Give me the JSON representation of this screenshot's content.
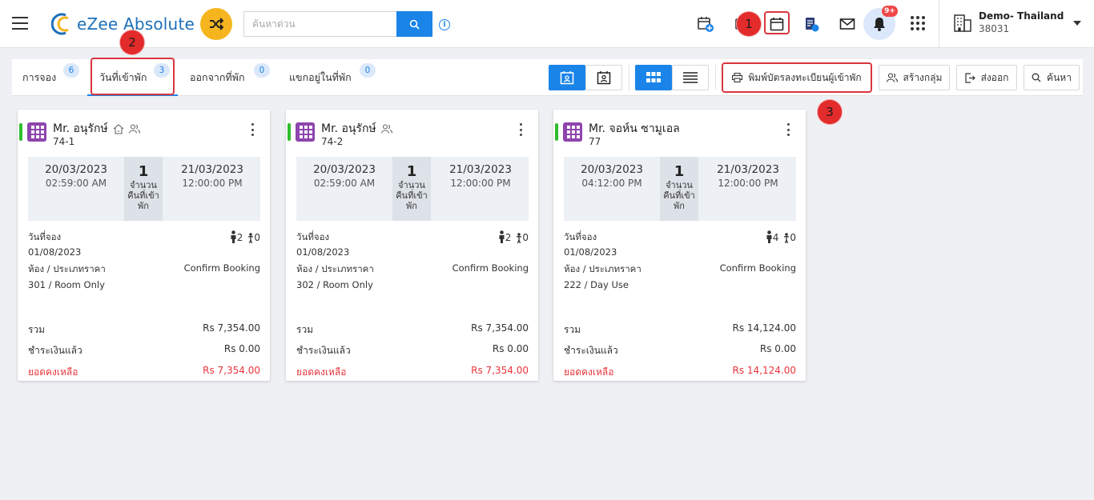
{
  "header": {
    "logo_text": "eZee Absolute",
    "search_placeholder": "ค้นหาด่วน",
    "notification_badge": "9+",
    "hotel_name": "Demo- Thailand",
    "hotel_id": "38031"
  },
  "steps": {
    "s1": "1",
    "s2": "2",
    "s3": "3"
  },
  "tabs": [
    {
      "label": "การจอง",
      "count": "6"
    },
    {
      "label": "วันที่เข้าพัก",
      "count": "3"
    },
    {
      "label": "ออกจากที่พัก",
      "count": "0"
    },
    {
      "label": "แขกอยู่ในที่พัก",
      "count": "0"
    }
  ],
  "toolbar": {
    "print_label": "พิมพ์บัตรลงทะเบียนผู้เข้าพัก",
    "group_label": "สร้างกลุ่ม",
    "export_label": "ส่งออก",
    "search_label": "ค้นหา"
  },
  "labels": {
    "nights": "จำนวนคืนที่เข้าพัก",
    "booking_date": "วันที่จอง",
    "room_rate": "ห้อง / ประเภทราคา",
    "total": "รวม",
    "paid": "ชำระเงินแล้ว",
    "balance": "ยอดคงเหลือ"
  },
  "cards": [
    {
      "guest": "Mr. อนุรักษ์",
      "booking_no": "74-1",
      "checkin_date": "20/03/2023",
      "checkin_time": "02:59:00 AM",
      "nights": "1",
      "checkout_date": "21/03/2023",
      "checkout_time": "12:00:00 PM",
      "booked_on": "01/08/2023",
      "adults": "2",
      "children": "0",
      "room": "301 / Room Only",
      "status": "Confirm Booking",
      "total": "Rs 7,354.00",
      "paid": "Rs 0.00",
      "balance": "Rs 7,354.00"
    },
    {
      "guest": "Mr. อนุรักษ์",
      "booking_no": "74-2",
      "checkin_date": "20/03/2023",
      "checkin_time": "02:59:00 AM",
      "nights": "1",
      "checkout_date": "21/03/2023",
      "checkout_time": "12:00:00 PM",
      "booked_on": "01/08/2023",
      "adults": "2",
      "children": "0",
      "room": "302 / Room Only",
      "status": "Confirm Booking",
      "total": "Rs 7,354.00",
      "paid": "Rs 0.00",
      "balance": "Rs 7,354.00"
    },
    {
      "guest": "Mr. จอห์น ซามูเอล",
      "booking_no": "77",
      "checkin_date": "20/03/2023",
      "checkin_time": "04:12:00 PM",
      "nights": "1",
      "checkout_date": "21/03/2023",
      "checkout_time": "12:00:00 PM",
      "booked_on": "01/08/2023",
      "adults": "4",
      "children": "0",
      "room": "222 / Day Use",
      "status": "Confirm Booking",
      "total": "Rs 14,124.00",
      "paid": "Rs 0.00",
      "balance": "Rs 14,124.00"
    }
  ]
}
